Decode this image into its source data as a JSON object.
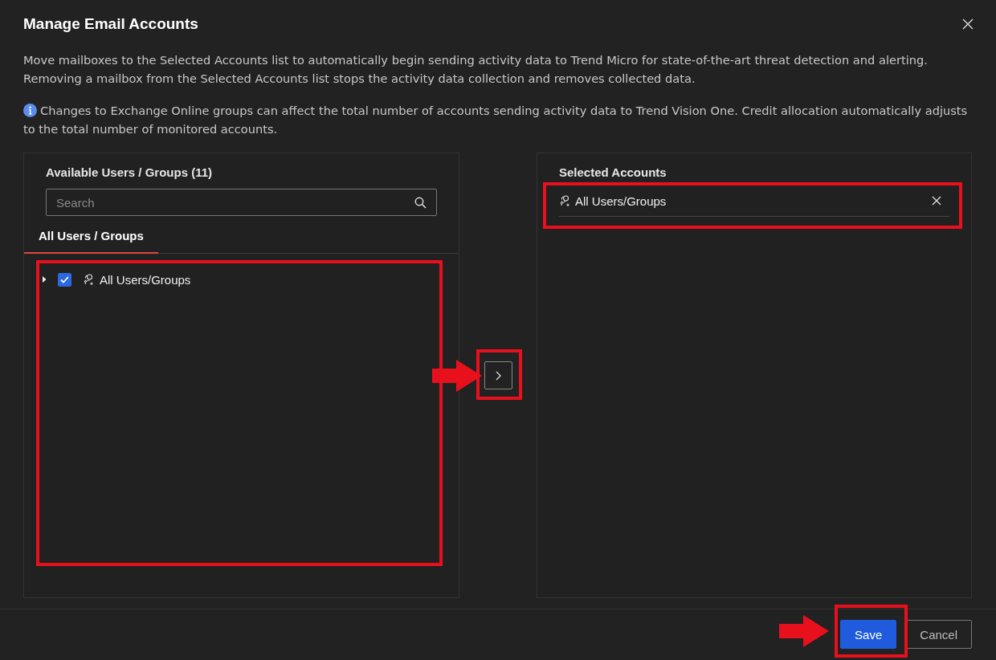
{
  "dialog": {
    "title": "Manage Email Accounts",
    "description": "Move mailboxes to the Selected Accounts list to automatically begin sending activity data to Trend Micro for state-of-the-art threat detection and alerting. Removing a mailbox from the Selected Accounts list stops the activity data collection and removes collected data.",
    "notice": "Changes to Exchange Online groups can affect the total number of accounts sending activity data to Trend Vision One. Credit allocation automatically adjusts to the total number of monitored accounts."
  },
  "available_panel": {
    "title": "Available Users / Groups (11)",
    "search": {
      "placeholder": "Search"
    },
    "tabs": [
      {
        "label": "All Users / Groups",
        "selected": true
      }
    ],
    "tree": [
      {
        "label": "All Users/Groups",
        "expanded": false,
        "checked": true
      }
    ]
  },
  "selected_panel": {
    "title": "Selected Accounts",
    "items": [
      {
        "label": "All Users/Groups"
      }
    ]
  },
  "footer": {
    "buttons": [
      {
        "label": "Save",
        "kind": "primary"
      },
      {
        "label": "Cancel",
        "kind": "secondary"
      }
    ]
  }
}
